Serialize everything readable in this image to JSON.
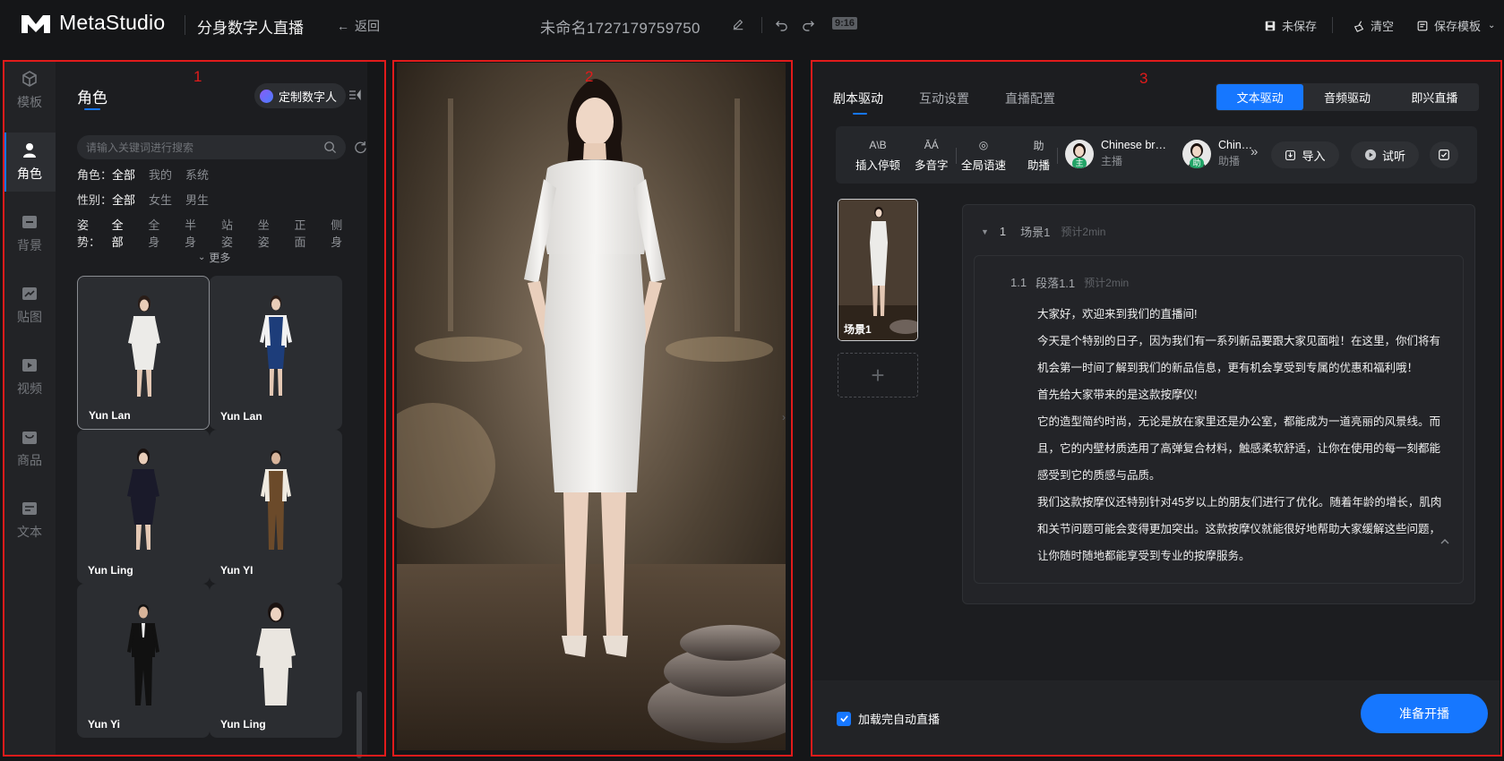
{
  "header": {
    "brand": "MetaStudio",
    "app_title": "分身数字人直播",
    "back_label": "返回",
    "doc_title": "未命名1727179759750",
    "aspect_ratio": "9:16",
    "unsaved_label": "未保存",
    "clear_label": "清空",
    "save_template_label": "保存模板"
  },
  "rail": {
    "items": [
      {
        "label": "模板",
        "icon": "cube-icon"
      },
      {
        "label": "角色",
        "icon": "person-icon",
        "active": true
      },
      {
        "label": "背景",
        "icon": "background-icon"
      },
      {
        "label": "贴图",
        "icon": "sticker-icon"
      },
      {
        "label": "视频",
        "icon": "video-icon"
      },
      {
        "label": "商品",
        "icon": "bag-icon"
      },
      {
        "label": "文本",
        "icon": "text-icon"
      }
    ]
  },
  "role_panel": {
    "title": "角色",
    "custom_button": "定制数字人",
    "search_placeholder": "请输入关键词进行搜索",
    "filters": [
      {
        "label": "角色：",
        "options": [
          "全部",
          "我的",
          "系统"
        ],
        "selected": "全部"
      },
      {
        "label": "性别：",
        "options": [
          "全部",
          "女生",
          "男生"
        ],
        "selected": "全部"
      },
      {
        "label": "姿势：",
        "options": [
          "全部",
          "全身",
          "半身",
          "站姿",
          "坐姿",
          "正面",
          "侧身"
        ],
        "selected": "全部"
      }
    ],
    "more_label": "更多",
    "cards": [
      {
        "name": "Yun Lan",
        "selected": true,
        "outfit": "#e8e4df"
      },
      {
        "name": "Yun Lan",
        "selected": false,
        "outfit": "#1d3d7a"
      },
      {
        "name": "Yun Ling",
        "selected": false,
        "outfit": "#1a1a2a"
      },
      {
        "name": "Yun YI",
        "selected": false,
        "outfit": "#6b4a2a"
      },
      {
        "name": "Yun Yi",
        "selected": false,
        "outfit": "#111111"
      },
      {
        "name": "Yun Ling",
        "selected": false,
        "outfit": "#eae6e0"
      }
    ]
  },
  "script_panel": {
    "tabs": [
      {
        "label": "剧本驱动",
        "active": true
      },
      {
        "label": "互动设置",
        "active": false
      },
      {
        "label": "直播配置",
        "active": false
      }
    ],
    "drive_modes": [
      {
        "label": "文本驱动",
        "active": true
      },
      {
        "label": "音频驱动",
        "active": false
      },
      {
        "label": "即兴直播",
        "active": false
      }
    ],
    "tools": [
      {
        "glyph": "A\\B",
        "label": "插入停顿"
      },
      {
        "glyph": "ĀÁ",
        "label": "多音字"
      },
      {
        "glyph": "◎",
        "label": "全局语速"
      },
      {
        "glyph": "助",
        "label": "助播"
      }
    ],
    "speakers": [
      {
        "name": "Chinese br…",
        "role": "主播",
        "badge": "主"
      },
      {
        "name": "Chinese",
        "role": "助播",
        "badge": "助"
      }
    ],
    "import_label": "导入",
    "listen_label": "试听",
    "scene_thumb_label": "场景1",
    "scene": {
      "index": "1",
      "name": "场景1",
      "estimate": "预计2min",
      "paragraph": {
        "index": "1.1",
        "name": "段落1.1",
        "estimate": "预计2min",
        "lines": [
          "大家好，欢迎来到我们的直播间!",
          "今天是个特别的日子，因为我们有一系列新品要跟大家见面啦！在这里，你们将有机会第一时间了解到我们的新品信息，更有机会享受到专属的优惠和福利哦！",
          "首先给大家带来的是这款按摩仪!",
          "它的造型简约时尚，无论是放在家里还是办公室，都能成为一道亮丽的风景线。而且，它的内壁材质选用了高弹复合材料，触感柔软舒适，让你在使用的每一刻都能感受到它的质感与品质。",
          "我们这款按摩仪还特别针对45岁以上的朋友们进行了优化。随着年龄的增长，肌肉和关节问题可能会变得更加突出。这款按摩仪就能很好地帮助大家缓解这些问题，让你随时随地都能享受到专业的按摩服务。"
        ]
      }
    },
    "auto_live_label": "加载完自动直播",
    "auto_live_checked": true,
    "start_label": "准备开播"
  },
  "annotations": {
    "label_1": "1",
    "label_2": "2",
    "label_3": "3"
  }
}
